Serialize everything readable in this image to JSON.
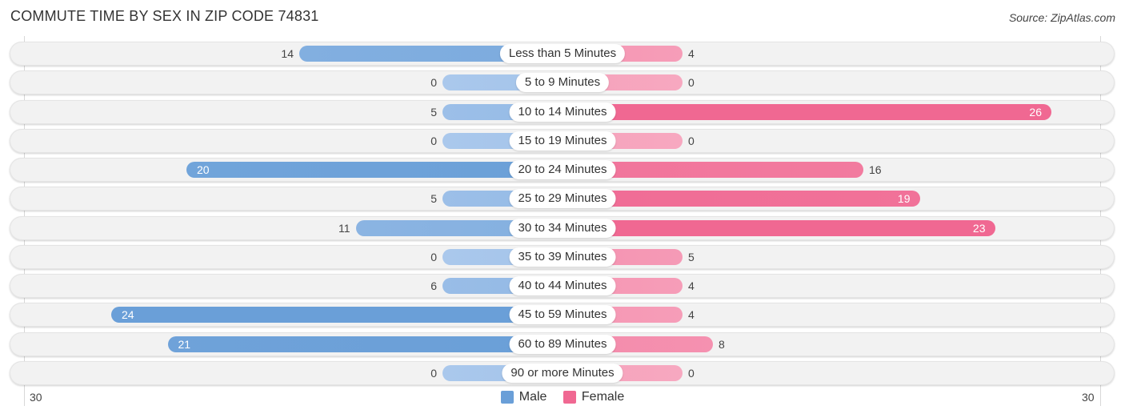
{
  "chart_data": {
    "type": "bar",
    "orientation": "horizontal-diverging",
    "title": "COMMUTE TIME BY SEX IN ZIP CODE 74831",
    "source": "Source: ZipAtlas.com",
    "categories": [
      "Less than 5 Minutes",
      "5 to 9 Minutes",
      "10 to 14 Minutes",
      "15 to 19 Minutes",
      "20 to 24 Minutes",
      "25 to 29 Minutes",
      "30 to 34 Minutes",
      "35 to 39 Minutes",
      "40 to 44 Minutes",
      "45 to 59 Minutes",
      "60 to 89 Minutes",
      "90 or more Minutes"
    ],
    "series": [
      {
        "name": "Male",
        "color": "#6a9fd8",
        "color_light": "#aac8ec",
        "values": [
          14,
          0,
          5,
          0,
          20,
          5,
          11,
          0,
          6,
          24,
          21,
          0
        ]
      },
      {
        "name": "Female",
        "color": "#f06892",
        "color_light": "#f7a8c0",
        "values": [
          4,
          0,
          26,
          0,
          16,
          19,
          23,
          5,
          4,
          4,
          8,
          0
        ]
      }
    ],
    "axis": {
      "left_tick": "30",
      "right_tick": "30",
      "xlim": [
        -30,
        30
      ]
    },
    "legend": {
      "placement": "bottom-center",
      "items": [
        "Male",
        "Female"
      ]
    },
    "grid": false
  }
}
